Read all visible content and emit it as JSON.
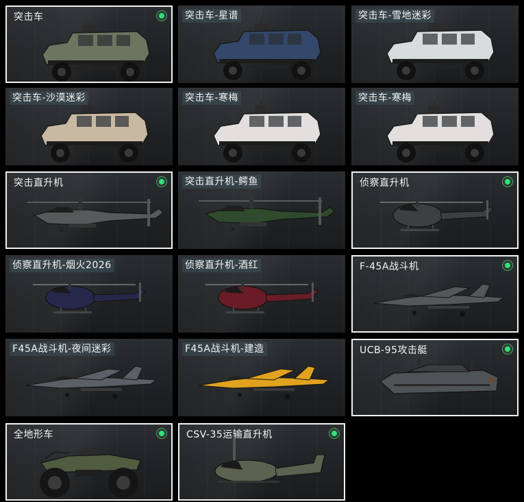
{
  "cards": [
    {
      "label": "突击车",
      "owned": true,
      "icon": "armored-car-icon",
      "color": "#6c7560"
    },
    {
      "label": "突击车-星谱",
      "owned": false,
      "icon": "armored-car-icon",
      "color": "#33486a"
    },
    {
      "label": "突击车-雪地迷彩",
      "owned": false,
      "icon": "armored-car-icon",
      "color": "#d9dcdc"
    },
    {
      "label": "突击车-沙漠迷彩",
      "owned": false,
      "icon": "armored-car-icon",
      "color": "#c8b9a2"
    },
    {
      "label": "突击车-寒梅",
      "owned": false,
      "icon": "armored-car-icon",
      "color": "#e2dfde"
    },
    {
      "label": "突击车-寒梅",
      "owned": false,
      "icon": "armored-car-icon",
      "color": "#e2dfde"
    },
    {
      "label": "突击直升机",
      "owned": true,
      "icon": "attack-helicopter-icon",
      "color": "#575a5a"
    },
    {
      "label": "突击直升机-鳄鱼",
      "owned": false,
      "icon": "attack-helicopter-icon",
      "color": "#2f4a2c"
    },
    {
      "label": "侦察直升机",
      "owned": true,
      "icon": "scout-helicopter-icon",
      "color": "#3c4040"
    },
    {
      "label": "侦察直升机-烟火2026",
      "owned": false,
      "icon": "scout-helicopter-icon",
      "color": "#25284a"
    },
    {
      "label": "侦察直升机-酒红",
      "owned": false,
      "icon": "scout-helicopter-icon",
      "color": "#6a1c26"
    },
    {
      "label": "F-45A战斗机",
      "owned": true,
      "icon": "fighter-jet-icon",
      "color": "#54585a"
    },
    {
      "label": "F45A战斗机-夜间迷彩",
      "owned": false,
      "icon": "fighter-jet-icon",
      "color": "#5b5f66"
    },
    {
      "label": "F45A战斗机-建造",
      "owned": false,
      "icon": "fighter-jet-icon",
      "color": "#e0a21f"
    },
    {
      "label": "UCB-95攻击艇",
      "owned": true,
      "icon": "attack-boat-icon",
      "color": "#4e5355"
    },
    {
      "label": "全地形车",
      "owned": true,
      "icon": "atv-icon",
      "color": "#4f5c3f"
    },
    {
      "label": "CSV-35运输直升机",
      "owned": true,
      "icon": "transport-helicopter-icon",
      "color": "#5d6150"
    }
  ]
}
